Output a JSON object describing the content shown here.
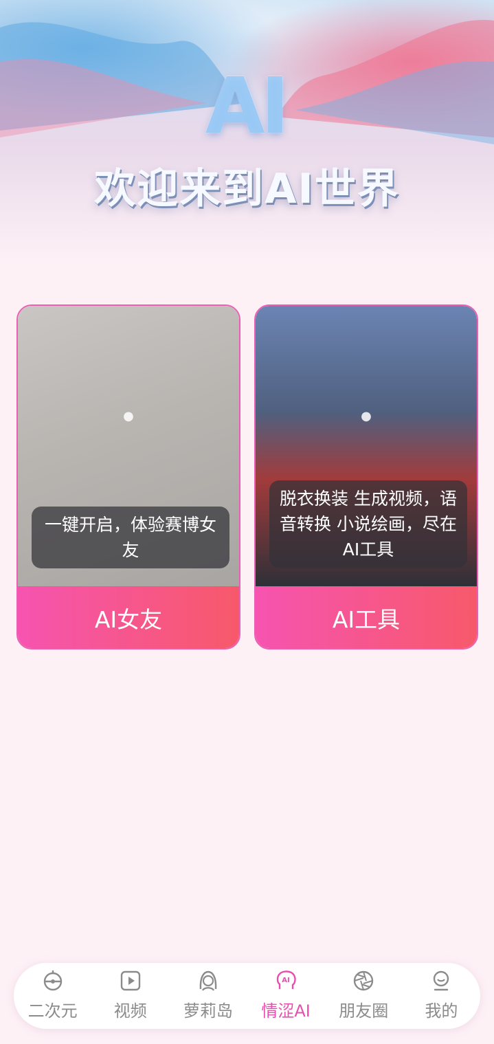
{
  "hero": {
    "logo_text": "AI",
    "title": "欢迎来到AI世界"
  },
  "cards": [
    {
      "caption": "一键开启，体验赛博女友",
      "button_label": "AI女友"
    },
    {
      "caption": "脱衣换装 生成视频，语音转换 小说绘画，尽在AI工具",
      "button_label": "AI工具"
    }
  ],
  "tabbar": {
    "active_index": 3,
    "active_color": "#e64fad",
    "inactive_color": "#8b8b8b",
    "items": [
      {
        "label": "二次元",
        "icon": "bell-icon"
      },
      {
        "label": "视频",
        "icon": "play-icon"
      },
      {
        "label": "萝莉岛",
        "icon": "girl-face-icon"
      },
      {
        "label": "情涩AI",
        "icon": "ai-head-icon"
      },
      {
        "label": "朋友圈",
        "icon": "aperture-icon"
      },
      {
        "label": "我的",
        "icon": "profile-icon"
      }
    ]
  },
  "colors": {
    "background": "#fdf1f6",
    "button_gradient_start": "#f654b0",
    "button_gradient_end": "#f7596a",
    "card_border": "#ea5fb2"
  }
}
